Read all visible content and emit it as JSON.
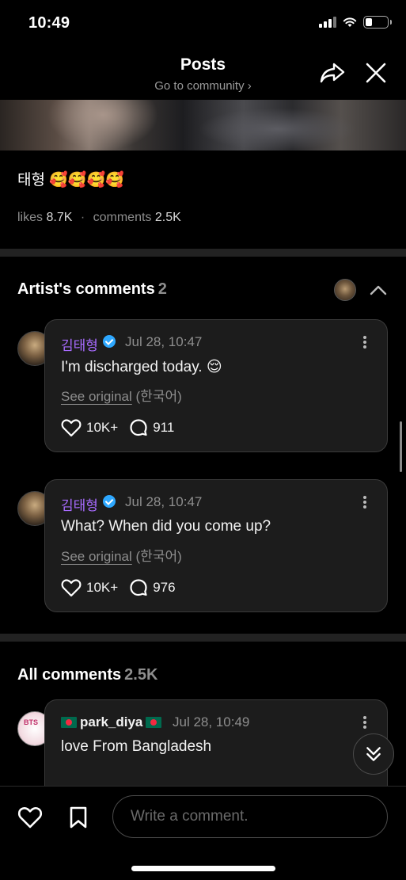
{
  "status_bar": {
    "time": "10:49",
    "battery_level": 0.3
  },
  "header": {
    "title": "Posts",
    "subtitle": "Go to community ›"
  },
  "post": {
    "text": "태형 🥰🥰🥰🥰",
    "likes_label": "likes",
    "likes_count": "8.7K",
    "separator": "·",
    "comments_label": "comments",
    "comments_count": "2.5K"
  },
  "artist_comments": {
    "title": "Artist's comments",
    "count": "2",
    "items": [
      {
        "author": "김태형",
        "date": "Jul 28, 10:47",
        "text": "I'm discharged today. 😌",
        "see_original": "See original",
        "language": "(한국어)",
        "likes": "10K+",
        "replies": "911"
      },
      {
        "author": "김태형",
        "date": "Jul 28, 10:47",
        "text": "What? When did you come up?",
        "see_original": "See original",
        "language": "(한국어)",
        "likes": "10K+",
        "replies": "976"
      }
    ]
  },
  "all_comments": {
    "title": "All comments",
    "count": "2.5K",
    "items": [
      {
        "avatar_text": "BTS",
        "author": "park_diya",
        "date": "Jul 28, 10:49",
        "text": "love From Bangladesh"
      }
    ]
  },
  "composer": {
    "placeholder": "Write a comment."
  },
  "icons": {
    "share": "share-arrow-icon",
    "close": "close-icon",
    "heart": "heart-icon",
    "bookmark": "bookmark-icon",
    "reply": "comment-bubble-icon",
    "more": "more-vertical-icon",
    "collapse": "chevron-up-icon",
    "scroll_down": "double-chevron-down-icon"
  },
  "colors": {
    "accent_purple": "#a86bff",
    "verified_blue": "#2ea8ff",
    "background": "#000000"
  }
}
